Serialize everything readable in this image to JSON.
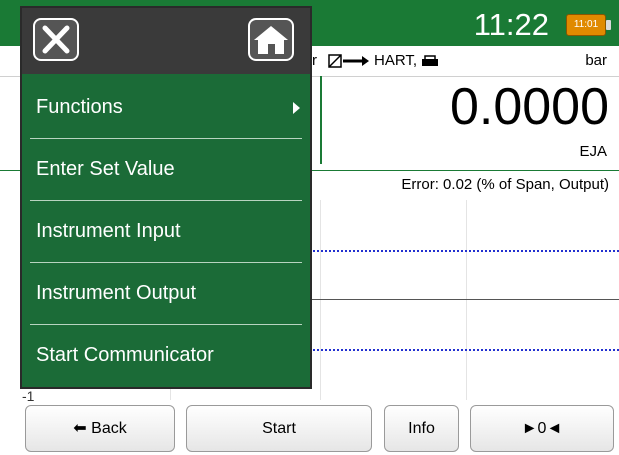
{
  "status": {
    "clock": "11:22",
    "battery_text": "11:01"
  },
  "measurement": {
    "hart_label": "HART,",
    "unit": "bar",
    "value": "0.0000",
    "tag": "EJA",
    "error_label": "Error: 0.02 (% of Span, Output)",
    "cutoff_text": "r"
  },
  "plot": {
    "ytick": "-1"
  },
  "menu": {
    "items": [
      {
        "label": "Functions",
        "has_submenu": true
      },
      {
        "label": "Enter Set Value"
      },
      {
        "label": "Instrument Input"
      },
      {
        "label": "Instrument Output"
      },
      {
        "label": "Start Communicator"
      }
    ]
  },
  "buttons": {
    "back": "Back",
    "start": "Start",
    "info": "Info",
    "zero": "►0◄"
  },
  "colors": {
    "accent": "#1a7a35",
    "battery": "#e08a00",
    "plot_line": "#2230d0"
  }
}
